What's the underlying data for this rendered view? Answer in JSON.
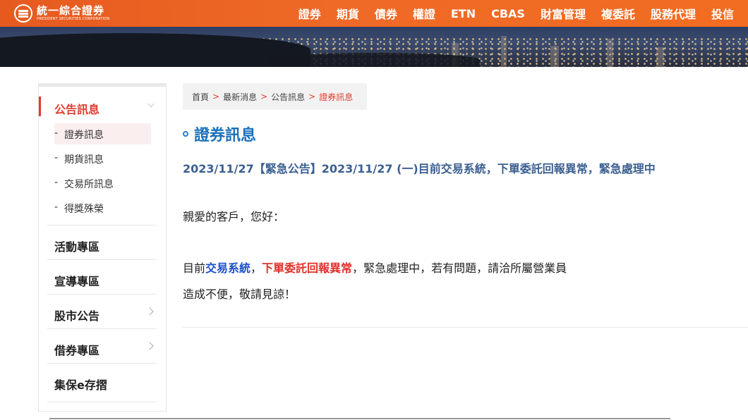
{
  "header": {
    "logo_cn": "統一綜合證券",
    "logo_en": "PRESIDENT SECURITIES CORPORATION",
    "nav": [
      "證券",
      "期貨",
      "債券",
      "權證",
      "ETN",
      "CBAS",
      "財富管理",
      "複委託",
      "股務代理",
      "投信"
    ]
  },
  "sidebar": {
    "section_title": "公告訊息",
    "sub_items": [
      "證券訊息",
      "期貨訊息",
      "交易所訊息",
      "得獎殊榮"
    ],
    "sub_dash": "-",
    "sections": [
      "活動專區",
      "宣導專區",
      "股市公告",
      "借券專區",
      "集保e存摺"
    ]
  },
  "breadcrumb": {
    "items": [
      "首頁",
      "最新消息",
      "公告訊息",
      "證券訊息"
    ],
    "separator": ">"
  },
  "content": {
    "page_title": "證券訊息",
    "headline": "2023/11/27【緊急公告】2023/11/27 (一)目前交易系統，下單委託回報異常，緊急處理中",
    "greeting": "親愛的客戶，您好：",
    "body_prefix": "目前",
    "body_blue": "交易系統",
    "body_comma": "，",
    "body_red": "下單委託回報異常",
    "body_rest": "，緊急處理中，若有問題，請洽所屬營業員",
    "body_line2": "造成不便，敬請見諒！"
  },
  "colors": {
    "header_orange": "#ef6a26",
    "accent_red": "#e03c2e",
    "title_blue": "#1a6fba",
    "headline_blue": "#3b5f91"
  }
}
